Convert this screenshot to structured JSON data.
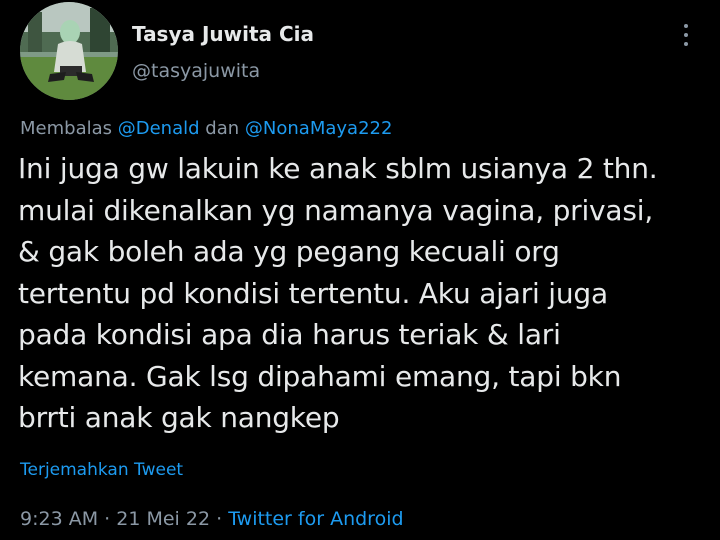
{
  "author": {
    "name": "Tasya Juwita Cia",
    "handle": "@tasyajuwita"
  },
  "reply": {
    "prefix": "Membalas",
    "user1": "@Denald",
    "connector": "dan",
    "user2": "@NonaMaya222"
  },
  "tweet_text": "Ini juga gw lakuin ke anak sblm usianya 2 thn.\nmulai dikenalkan yg namanya vagina, privasi,\n& gak boleh ada yg pegang kecuali org\ntertentu pd kondisi tertentu. Aku ajari juga\npada kondisi apa dia harus teriak & lari\nkemana. Gak lsg dipahami emang, tapi bkn\nbrrti anak gak nangkep",
  "translate_label": "Terjemahkan Tweet",
  "meta": {
    "time": "9:23 AM",
    "separator": "·",
    "date": "21 Mei 22",
    "source": "Twitter for Android"
  },
  "colors": {
    "background": "#000000",
    "text": "#e7e9ea",
    "secondary": "#8b98a5",
    "link": "#1d9bf0"
  },
  "icons": {
    "more": "more-vertical-icon"
  }
}
